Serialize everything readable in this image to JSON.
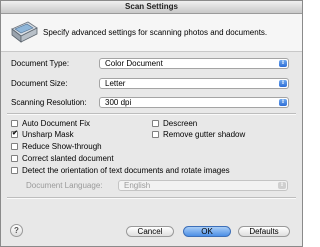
{
  "window": {
    "title": "Scan Settings"
  },
  "header": {
    "text": "Specify advanced settings for scanning photos and documents."
  },
  "fields": {
    "document_type": {
      "label": "Document Type:",
      "value": "Color Document"
    },
    "document_size": {
      "label": "Document Size:",
      "value": "Letter"
    },
    "scanning_resolution": {
      "label": "Scanning Resolution:",
      "value": "300 dpi"
    },
    "document_language": {
      "label": "Document Language:",
      "value": "English"
    }
  },
  "options": {
    "auto_document_fix": {
      "label": "Auto Document Fix",
      "checked": false
    },
    "descreen": {
      "label": "Descreen",
      "checked": false
    },
    "unsharp_mask": {
      "label": "Unsharp Mask",
      "checked": true
    },
    "remove_gutter_shadow": {
      "label": "Remove gutter shadow",
      "checked": false
    },
    "reduce_show_through": {
      "label": "Reduce Show-through",
      "checked": false
    },
    "correct_slanted": {
      "label": "Correct slanted document",
      "checked": false
    },
    "detect_orientation": {
      "label": "Detect the orientation of text documents and rotate images",
      "checked": false
    }
  },
  "buttons": {
    "help": "?",
    "cancel": "Cancel",
    "ok": "OK",
    "defaults": "Defaults"
  },
  "icons": {
    "check": "✔",
    "arrows": "⇕"
  },
  "colors": {
    "accent": "#4c8fe6",
    "window_bg": "#e8e8e8"
  }
}
